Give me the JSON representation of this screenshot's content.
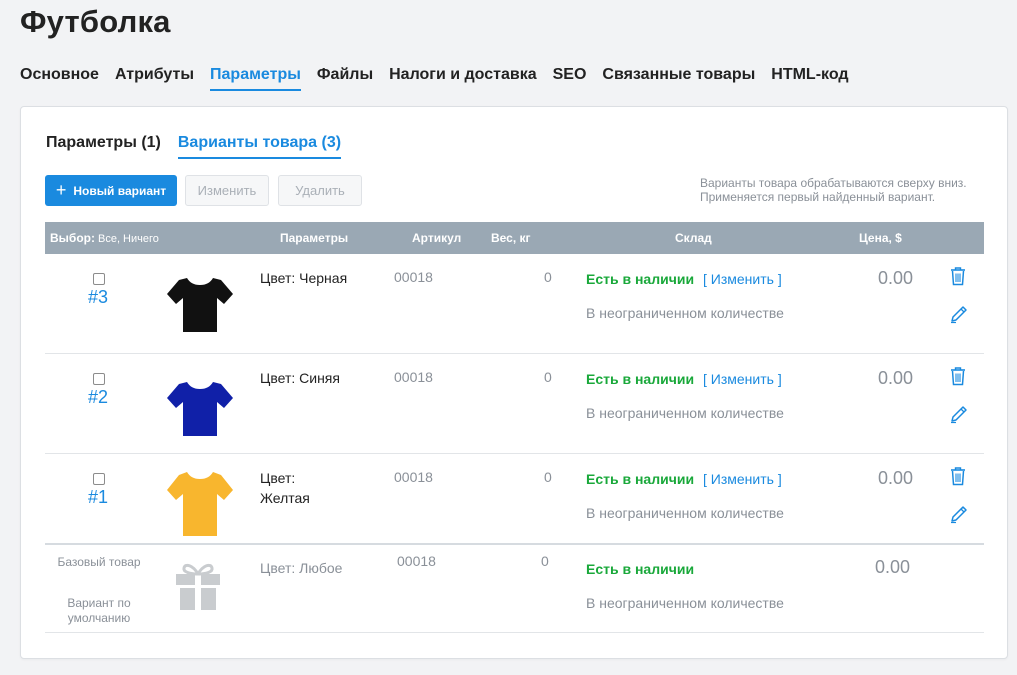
{
  "page": {
    "title": "Футболка"
  },
  "main_tabs": [
    {
      "label": "Основное",
      "active": false
    },
    {
      "label": "Атрибуты",
      "active": false
    },
    {
      "label": "Параметры",
      "active": true
    },
    {
      "label": "Файлы",
      "active": false
    },
    {
      "label": "Налоги и доставка",
      "active": false
    },
    {
      "label": "SEO",
      "active": false
    },
    {
      "label": "Связанные товары",
      "active": false
    },
    {
      "label": "HTML-код",
      "active": false
    }
  ],
  "sub_tabs": [
    {
      "label": "Параметры (1)",
      "active": false
    },
    {
      "label": "Варианты товара (3)",
      "active": true
    }
  ],
  "toolbar": {
    "new_variant_label": "Новый вариант",
    "edit_label": "Изменить",
    "delete_label": "Удалить"
  },
  "hint": {
    "line1": "Варианты товара обрабатываются сверху вниз.",
    "line2": "Применяется первый найденный вариант."
  },
  "table": {
    "headers": {
      "select": "Выбор:",
      "select_links": "Все, Ничего",
      "params": "Параметры",
      "sku": "Артикул",
      "weight": "Вес, кг",
      "stock": "Склад",
      "price": "Цена, $"
    },
    "rows": [
      {
        "number": "#3",
        "param": "Цвет: Черная",
        "sku": "00018",
        "weight": "0",
        "stock_status": "Есть в наличии",
        "change_link": "[ Изменить ]",
        "quantity": "В неограниченном количестве",
        "price": "0.00",
        "shirt_color": "#111111"
      },
      {
        "number": "#2",
        "param": "Цвет: Синяя",
        "sku": "00018",
        "weight": "0",
        "stock_status": "Есть в наличии",
        "change_link": "[ Изменить ]",
        "quantity": "В неограниченном количестве",
        "price": "0.00",
        "shirt_color": "#1020a8"
      },
      {
        "number": "#1",
        "param": "Цвет:\nЖелтая",
        "sku": "00018",
        "weight": "0",
        "stock_status": "Есть в наличии",
        "change_link": "[ Изменить ]",
        "quantity": "В неограниченном количестве",
        "price": "0.00",
        "shirt_color": "#f8b62e"
      }
    ],
    "base_row": {
      "label1": "Базовый товар",
      "label2": "Вариант по умолчанию",
      "param": "Цвет: Любое",
      "sku": "00018",
      "weight": "0",
      "stock_status": "Есть в наличии",
      "quantity": "В неограниченном количестве",
      "price": "0.00"
    }
  },
  "colors": {
    "accent": "#1a8adf",
    "in_stock": "#19a83a",
    "header_bg": "#9aa8b4",
    "muted_text": "#8a9098"
  }
}
